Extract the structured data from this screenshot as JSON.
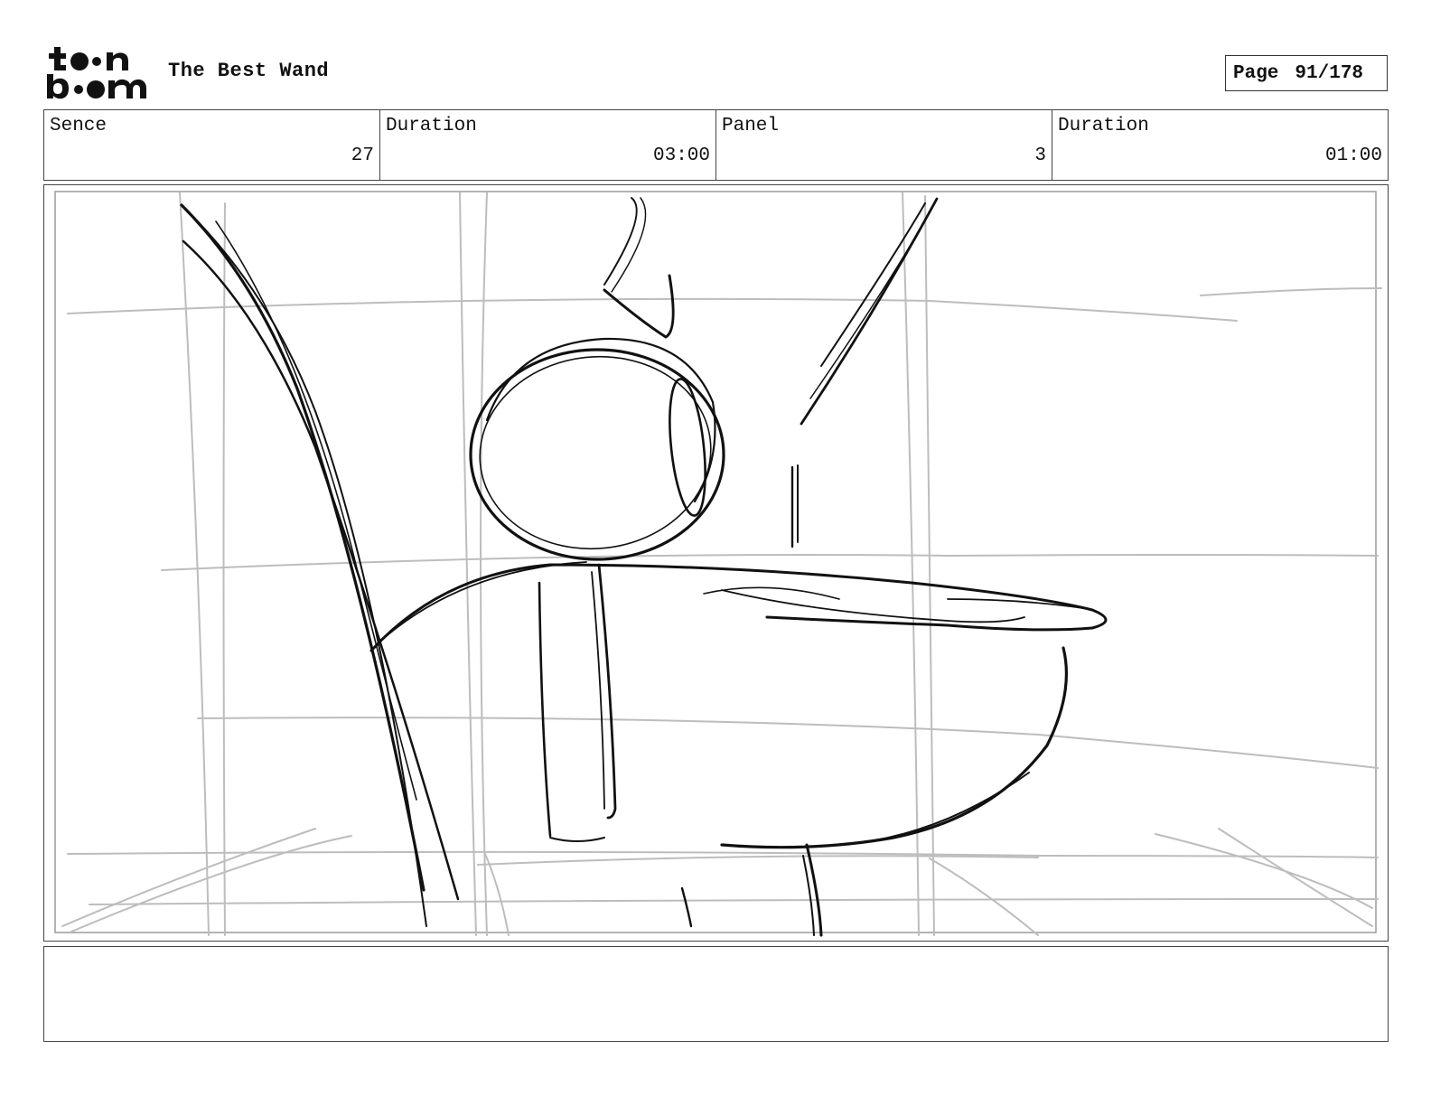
{
  "header": {
    "logo": "toon boom",
    "project_title": "The Best Wand",
    "page_label": "Page",
    "page_value": "91/178"
  },
  "info": {
    "scene_label": "Sence",
    "scene_value": "27",
    "scene_duration_label": "Duration",
    "scene_duration_value": "03:00",
    "panel_label": "Panel",
    "panel_value": "3",
    "panel_duration_label": "Duration",
    "panel_duration_value": "01:00"
  },
  "notes": {
    "text": ""
  },
  "colors": {
    "sketch": "#111111",
    "guide": "#bdbdbd"
  }
}
